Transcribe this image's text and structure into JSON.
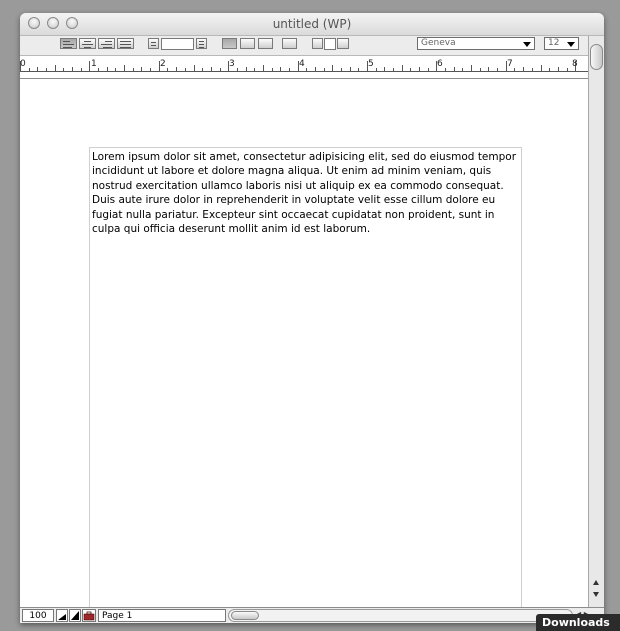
{
  "window": {
    "title": "untitled (WP)"
  },
  "toolbar": {
    "font_select": "Geneva",
    "size_select": "12"
  },
  "ruler": {
    "labels": [
      "0",
      "1",
      "2",
      "3",
      "4",
      "5",
      "6",
      "7",
      "8"
    ]
  },
  "document": {
    "body_text": "Lorem ipsum dolor sit amet, consectetur adipisicing elit, sed do eiusmod tempor incididunt ut labore et dolore magna aliqua. Ut enim ad minim veniam, quis nostrud exercitation ullamco laboris nisi ut aliquip ex ea commodo consequat. Duis aute irure dolor in reprehenderit in voluptate velit esse cillum dolore eu fugiat nulla pariatur. Excepteur sint occaecat cupidatat non proident, sunt in culpa qui officia deserunt mollit anim id est laborum."
  },
  "status": {
    "zoom": "100",
    "page_indicator": "Page 1"
  },
  "overlay": {
    "badge": "Downloads"
  }
}
